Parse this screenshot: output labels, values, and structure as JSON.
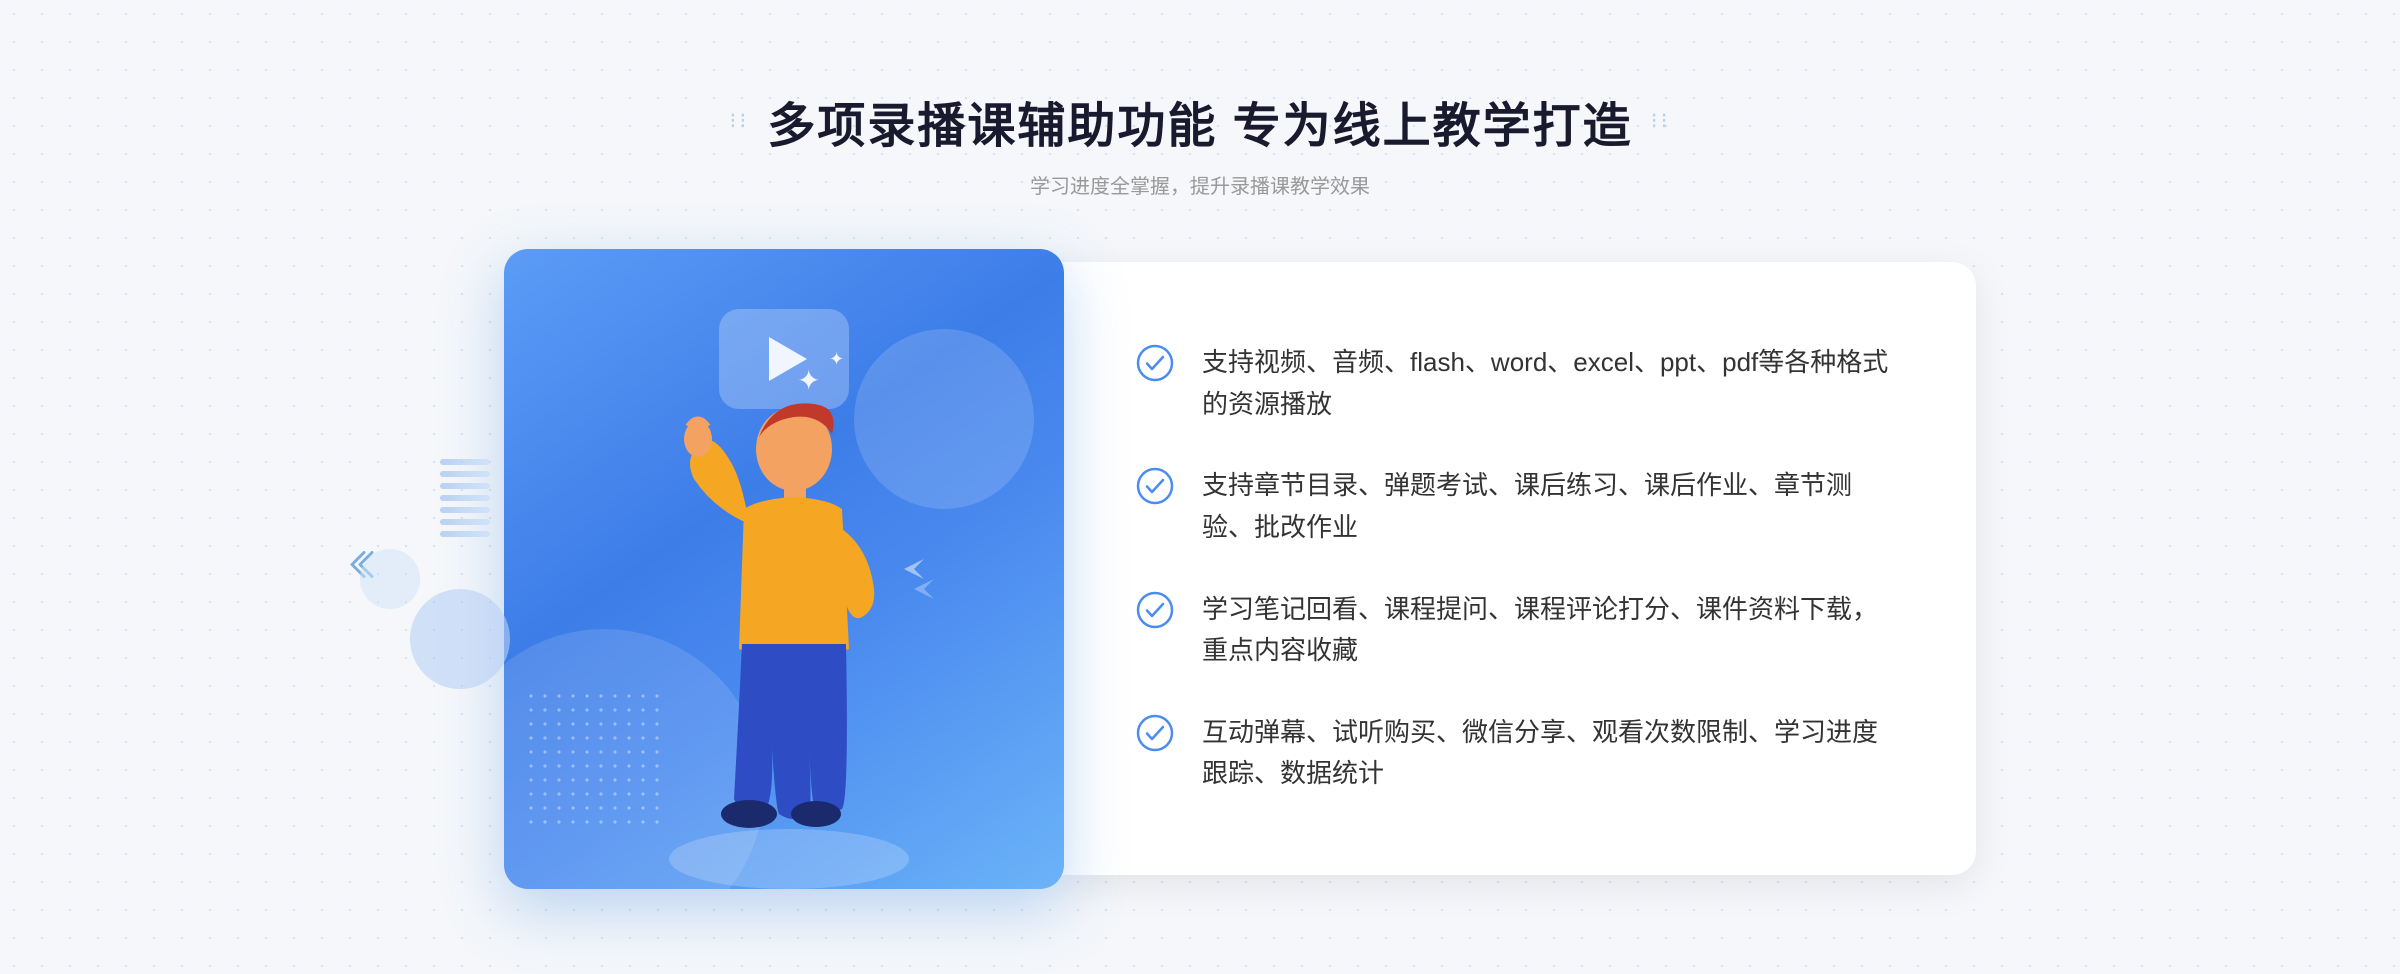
{
  "header": {
    "deco_left": "⠿ ⠿",
    "deco_right": "⠿ ⠿",
    "title": "多项录播课辅助功能 专为线上教学打造",
    "subtitle": "学习进度全掌握，提升录播课教学效果"
  },
  "features": [
    {
      "id": "feature-1",
      "text": "支持视频、音频、flash、word、excel、ppt、pdf等各种格式的资源播放"
    },
    {
      "id": "feature-2",
      "text": "支持章节目录、弹题考试、课后练习、课后作业、章节测验、批改作业"
    },
    {
      "id": "feature-3",
      "text": "学习笔记回看、课程提问、课程评论打分、课件资料下载，重点内容收藏"
    },
    {
      "id": "feature-4",
      "text": "互动弹幕、试听购买、微信分享、观看次数限制、学习进度跟踪、数据统计"
    }
  ],
  "colors": {
    "primary_blue": "#4a8cf0",
    "check_circle": "#4a8cf0",
    "title_dark": "#1a1a2e",
    "subtitle_gray": "#999999",
    "feature_text": "#333333",
    "bg_light": "#f5f7fa"
  },
  "icons": {
    "check": "check-circle-icon",
    "play": "play-icon",
    "chevron_left": "chevron-left-icon",
    "deco_grid": "decoration-grid"
  },
  "illustration": {
    "alt": "录播课辅助功能插图 - 指向前方的教师"
  }
}
